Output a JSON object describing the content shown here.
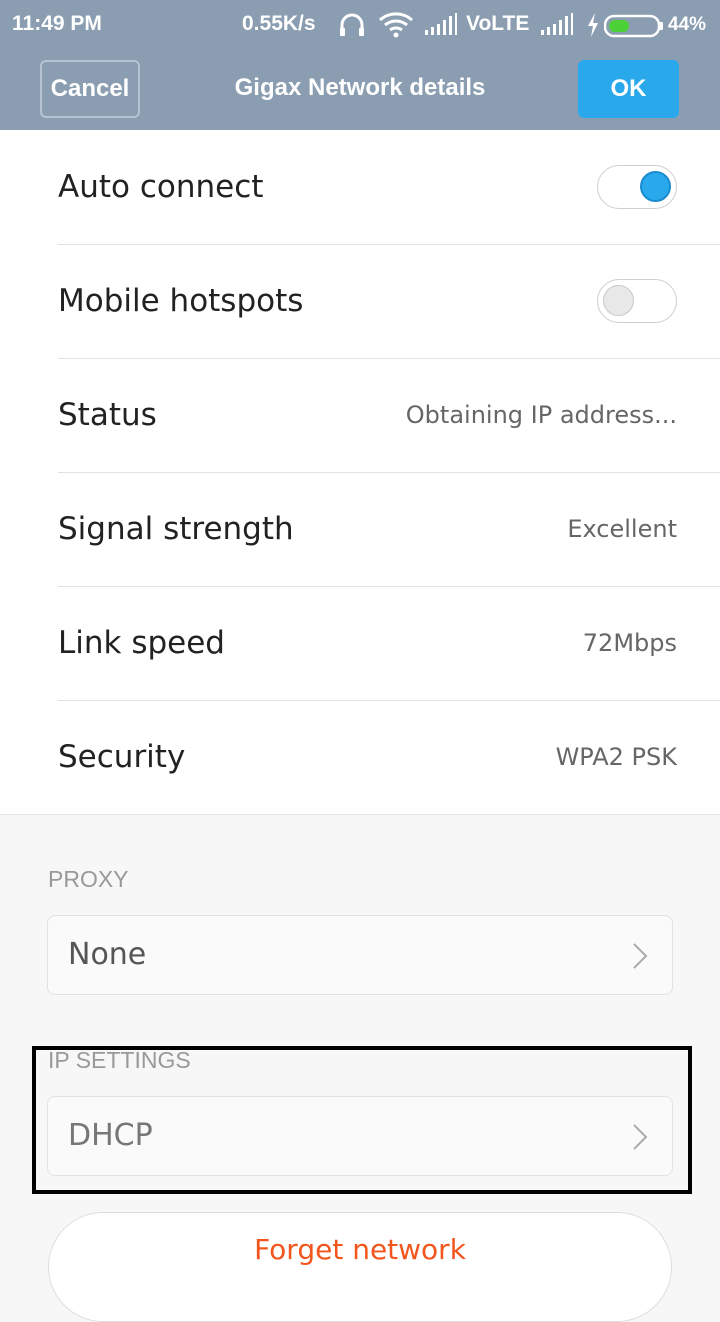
{
  "status_bar": {
    "time": "11:49 PM",
    "speed": "0.55K/s",
    "network": "VoLTE",
    "battery": "44%",
    "battery_level": 0.44,
    "icons": [
      "headphones-icon",
      "wifi-icon",
      "signal-icon",
      "signal-icon",
      "charging-icon",
      "battery-icon"
    ]
  },
  "header": {
    "cancel_label": "Cancel",
    "title": "Gigax Network details",
    "ok_label": "OK"
  },
  "settings": {
    "auto_connect": {
      "label": "Auto connect",
      "enabled": true
    },
    "mobile_hotspots": {
      "label": "Mobile hotspots",
      "enabled": false
    },
    "status": {
      "label": "Status",
      "value": "Obtaining IP address..."
    },
    "signal_strength": {
      "label": "Signal strength",
      "value": "Excellent"
    },
    "link_speed": {
      "label": "Link speed",
      "value": "72Mbps"
    },
    "security": {
      "label": "Security",
      "value": "WPA2 PSK"
    }
  },
  "proxy": {
    "header": "PROXY",
    "value": "None"
  },
  "ip_settings": {
    "header": "IP SETTINGS",
    "value": "DHCP"
  },
  "forget_label": "Forget network",
  "colors": {
    "header_bg": "#8a9db1",
    "accent": "#2aa8ec",
    "forget_text": "#f2561d"
  }
}
